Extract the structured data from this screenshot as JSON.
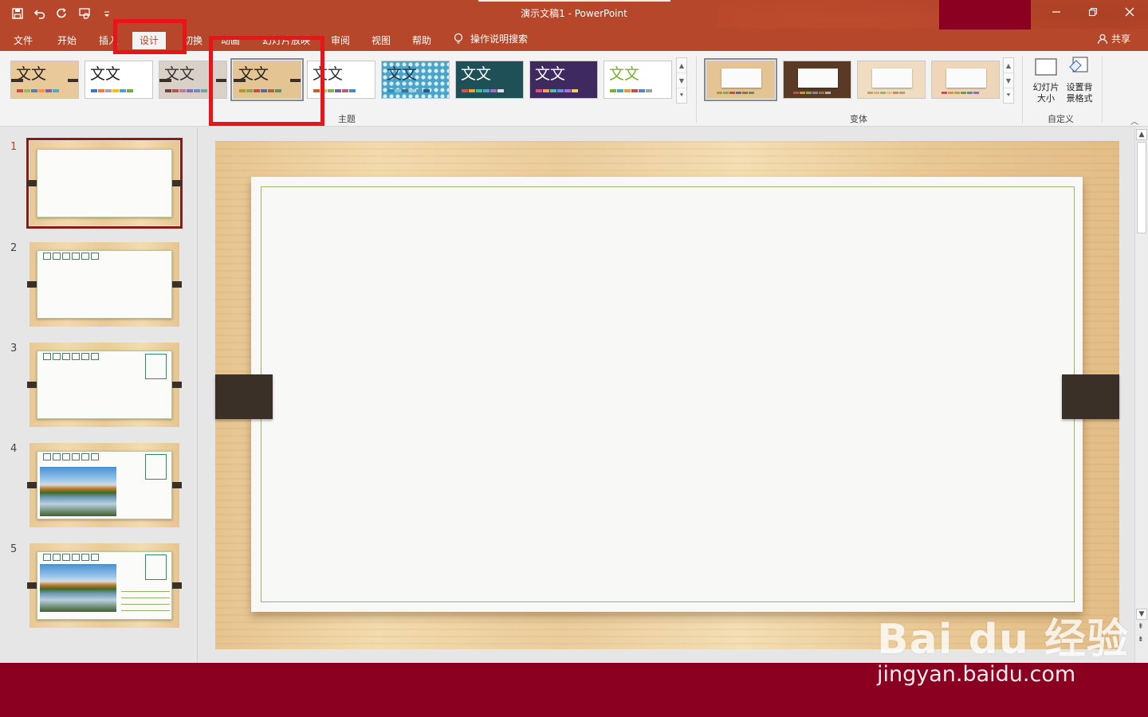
{
  "window": {
    "title": "演示文稿1  -  PowerPoint",
    "controls": [
      "minimize-icon",
      "restore-icon",
      "close-icon"
    ]
  },
  "quick_access": [
    "save-icon",
    "undo-icon",
    "redo-icon",
    "present-from-beginning-icon",
    "customize-qat-icon"
  ],
  "tabs": {
    "file": "文件",
    "home": "开始",
    "insert": "插入",
    "design": "设计",
    "transitions": "切换",
    "animations": "动画",
    "slideshow": "幻灯片放映",
    "review": "审阅",
    "view": "视图",
    "help": "帮助",
    "active": "设计"
  },
  "tell_me": "操作说明搜索",
  "share": "共享",
  "ribbon": {
    "themes_label": "主题",
    "variants_label": "变体",
    "customize_label": "自定义",
    "theme_sample_text": "文文",
    "themes": [
      {
        "bg": "#e9c999",
        "fg": "#222222",
        "selected": false,
        "colors": [
          "#c0504d",
          "#9bbb59",
          "#4f81bd",
          "#f79646",
          "#8064a2",
          "#4bacc6"
        ]
      },
      {
        "bg": "#ffffff",
        "fg": "#222222",
        "selected": false,
        "colors": [
          "#4472c4",
          "#ed7d31",
          "#a5a5a5",
          "#ffc000",
          "#5b9bd5",
          "#70ad47"
        ]
      },
      {
        "bg": "#d9d0c8",
        "fg": "#333333",
        "selected": false,
        "colors": [
          "#7e3d3d",
          "#b25757",
          "#c07b9b",
          "#8d6fb0",
          "#6a8fc4",
          "#70a5a0"
        ]
      },
      {
        "bg": "#e4c492",
        "fg": "#222222",
        "selected": true,
        "colors": [
          "#b2962f",
          "#8fa54f",
          "#c0504d",
          "#4f6f9f",
          "#a46b3c",
          "#6c8e5f"
        ]
      },
      {
        "bg": "#ffffff",
        "fg": "#333333",
        "selected": false,
        "colors": [
          "#d05c28",
          "#e6b74b",
          "#85b14e",
          "#7c5fa3",
          "#c65a6b",
          "#3f8ec1"
        ]
      },
      {
        "bg": "#4aa3c8",
        "fg": "#1c3b4a",
        "selected": false,
        "colors": [
          "#2f8fb8",
          "#7ac3d8",
          "#3f6f8f",
          "#9fd0e0",
          "#5a9fc0",
          "#1f5f7f"
        ]
      },
      {
        "bg": "#1f4f57",
        "fg": "#ffffff",
        "selected": false,
        "colors": [
          "#e04f3f",
          "#f0a030",
          "#3fbf8f",
          "#4fa0d0",
          "#a070c0",
          "#e0e0e0"
        ]
      },
      {
        "bg": "#3f2a5f",
        "fg": "#ffffff",
        "selected": false,
        "colors": [
          "#e04f7f",
          "#f0a050",
          "#50c0a0",
          "#6090e0",
          "#b070d0",
          "#f0d060"
        ]
      },
      {
        "bg": "#ffffff",
        "fg": "#7ab02f",
        "selected": false,
        "colors": [
          "#7ab02f",
          "#4fa0c0",
          "#e0a030",
          "#c05050",
          "#6080c0",
          "#a0a0a0"
        ]
      }
    ],
    "variants": [
      {
        "bg": "#e4c492",
        "selected": true,
        "colors": [
          "#b2962f",
          "#8fa54f",
          "#c0504d",
          "#4f6f9f",
          "#a46b3c",
          "#6c8e5f"
        ]
      },
      {
        "bg": "#5a3a24",
        "selected": false,
        "colors": [
          "#c0504d",
          "#d09040",
          "#8fa54f",
          "#6f8fbf",
          "#a0703f",
          "#b0b0b0"
        ]
      },
      {
        "bg": "#f0dcc0",
        "selected": false,
        "colors": [
          "#c0a070",
          "#d0b080",
          "#a0b070",
          "#e0c090",
          "#c09060",
          "#b0a080"
        ]
      },
      {
        "bg": "#efd6b8",
        "selected": false,
        "colors": [
          "#d04f4f",
          "#e08f3f",
          "#c0a040",
          "#6f9f4f",
          "#4f8fbf",
          "#8f6fbf"
        ]
      }
    ],
    "slide_size_label": "幻灯片大小",
    "format_bg_label": "设置背景格式"
  },
  "thumbnails": [
    {
      "number": "1",
      "active": true,
      "layout": "blank"
    },
    {
      "number": "2",
      "active": false,
      "layout": "postcard-boxes"
    },
    {
      "number": "3",
      "active": false,
      "layout": "postcard-stamp"
    },
    {
      "number": "4",
      "active": false,
      "layout": "postcard-photo"
    },
    {
      "number": "5",
      "active": false,
      "layout": "postcard-photo-lines"
    }
  ],
  "watermark": {
    "logo": "Bai du 经验",
    "url": "jingyan.baidu.com"
  },
  "colors": {
    "accent": "#b7472a",
    "highlight": "#e8141a",
    "status_bar": "#8b0021"
  }
}
